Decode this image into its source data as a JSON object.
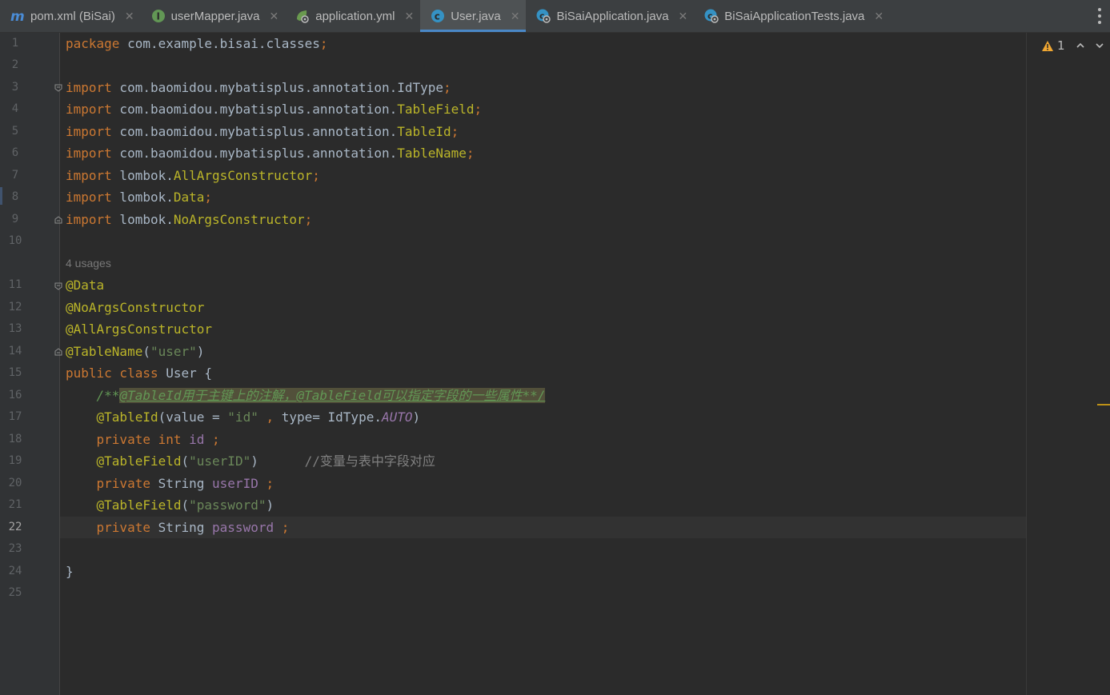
{
  "tabs": [
    {
      "label": "pom.xml (BiSai)",
      "icon": "maven-icon",
      "active": false
    },
    {
      "label": "userMapper.java",
      "icon": "interface-icon",
      "active": false
    },
    {
      "label": "application.yml",
      "icon": "yaml-config-icon",
      "active": false
    },
    {
      "label": "User.java",
      "icon": "class-icon",
      "active": true
    },
    {
      "label": "BiSaiApplication.java",
      "icon": "spring-class-icon",
      "active": false
    },
    {
      "label": "BiSaiApplicationTests.java",
      "icon": "spring-class-icon",
      "active": false
    }
  ],
  "close_glyph": "✕",
  "inspection": {
    "warning_count": "1"
  },
  "line_numbers": [
    "1",
    "2",
    "3",
    "4",
    "5",
    "6",
    "7",
    "8",
    "9",
    "10",
    "11",
    "12",
    "13",
    "14",
    "15",
    "16",
    "17",
    "18",
    "19",
    "20",
    "21",
    "22",
    "23",
    "24",
    "25"
  ],
  "current_line": "22",
  "usages_hint": "4 usages",
  "code": {
    "l1": {
      "kw": "package",
      "pkg": " com.example.bisai.classes",
      "semi": ";"
    },
    "l3": {
      "kw": "import",
      "pkg": " com.baomidou.mybatisplus.annotation.",
      "name": "IdType",
      "semi": ";"
    },
    "l4": {
      "kw": "import",
      "pkg": " com.baomidou.mybatisplus.annotation.",
      "name": "TableField",
      "semi": ";"
    },
    "l5": {
      "kw": "import",
      "pkg": " com.baomidou.mybatisplus.annotation.",
      "name": "TableId",
      "semi": ";"
    },
    "l6": {
      "kw": "import",
      "pkg": " com.baomidou.mybatisplus.annotation.",
      "name": "TableName",
      "semi": ";"
    },
    "l7": {
      "kw": "import",
      "pkg": " lombok.",
      "name": "AllArgsConstructor",
      "semi": ";"
    },
    "l8": {
      "kw": "import",
      "pkg": " lombok.",
      "name": "Data",
      "semi": ";"
    },
    "l9": {
      "kw": "import",
      "pkg": " lombok.",
      "name": "NoArgsConstructor",
      "semi": ";"
    },
    "l11": "@Data",
    "l12": "@NoArgsConstructor",
    "l13": "@AllArgsConstructor",
    "l14": {
      "ann": "@TableName",
      "open": "(",
      "str": "\"user\"",
      "close": ")"
    },
    "l15": {
      "kw1": "public",
      "kw2": " class",
      "name": " User {"
    },
    "l16": {
      "start": "/**",
      "body": "@TableId用于主键上的注解，@TableField可以指定字段的一些属性**/"
    },
    "l17": {
      "ann": "@TableId",
      "a": "(value = ",
      "str": "\"id\"",
      "b": " , ",
      "c": "type= IdType.",
      "konst": "AUTO",
      "d": ")"
    },
    "l18": {
      "kw1": "private",
      "kw2": " int",
      "name": " id ",
      "semi": ";"
    },
    "l19": {
      "ann": "@TableField",
      "open": "(",
      "str": "\"userID\"",
      "close": ")",
      "comment": "      //变量与表中字段对应"
    },
    "l20": {
      "kw": "private",
      "type": " String ",
      "fld": "userID",
      "semi": " ;"
    },
    "l21": {
      "ann": "@TableField",
      "open": "(",
      "str": "\"password\"",
      "close": ")"
    },
    "l22": {
      "kw": "private",
      "type": " String ",
      "fld": "password",
      "semi": " ;"
    },
    "l24": "}"
  },
  "colors": {
    "background": "#2b2b2b",
    "keyword": "#cc7832",
    "annotation": "#bbb529",
    "string": "#6a8759",
    "doc_comment": "#629755",
    "field": "#9876aa",
    "active_tab_underline": "#4a88c7",
    "warning": "#be9117"
  }
}
